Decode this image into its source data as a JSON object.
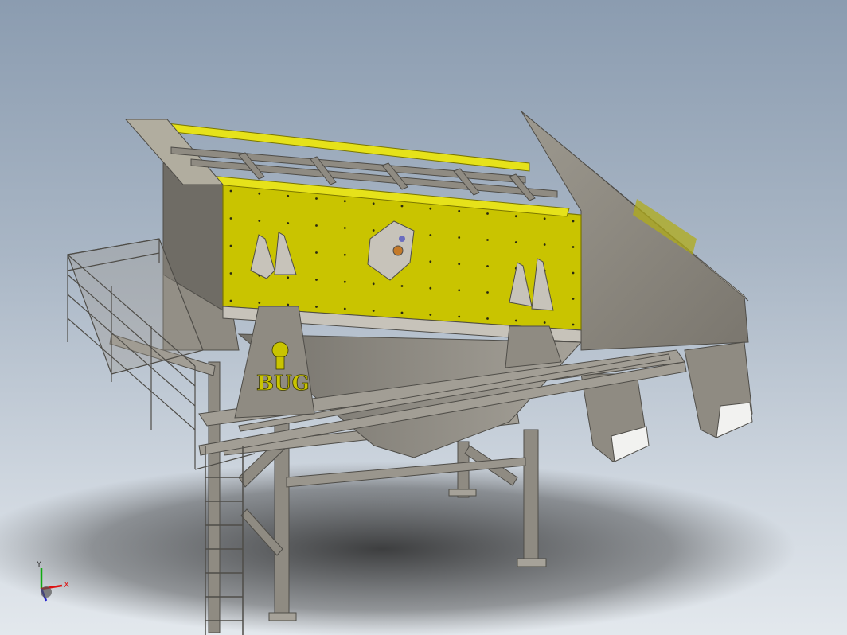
{
  "viewport": {
    "description_free": true
  },
  "model": {
    "logo_text": "BUG",
    "colors": {
      "body_yellow": "#c9c400",
      "rail_yellow": "#e6e21a",
      "steel": "#8f8b82",
      "steel_dark": "#6b6861",
      "steel_light": "#b3afa6",
      "background_top": "#8b9cb0",
      "background_bottom": "#e3e8ed"
    }
  },
  "triad": {
    "x_label": "X",
    "y_label": "Y",
    "z_label": "Z",
    "colors": {
      "x": "#d11",
      "y": "#1a1",
      "z": "#22c"
    }
  }
}
